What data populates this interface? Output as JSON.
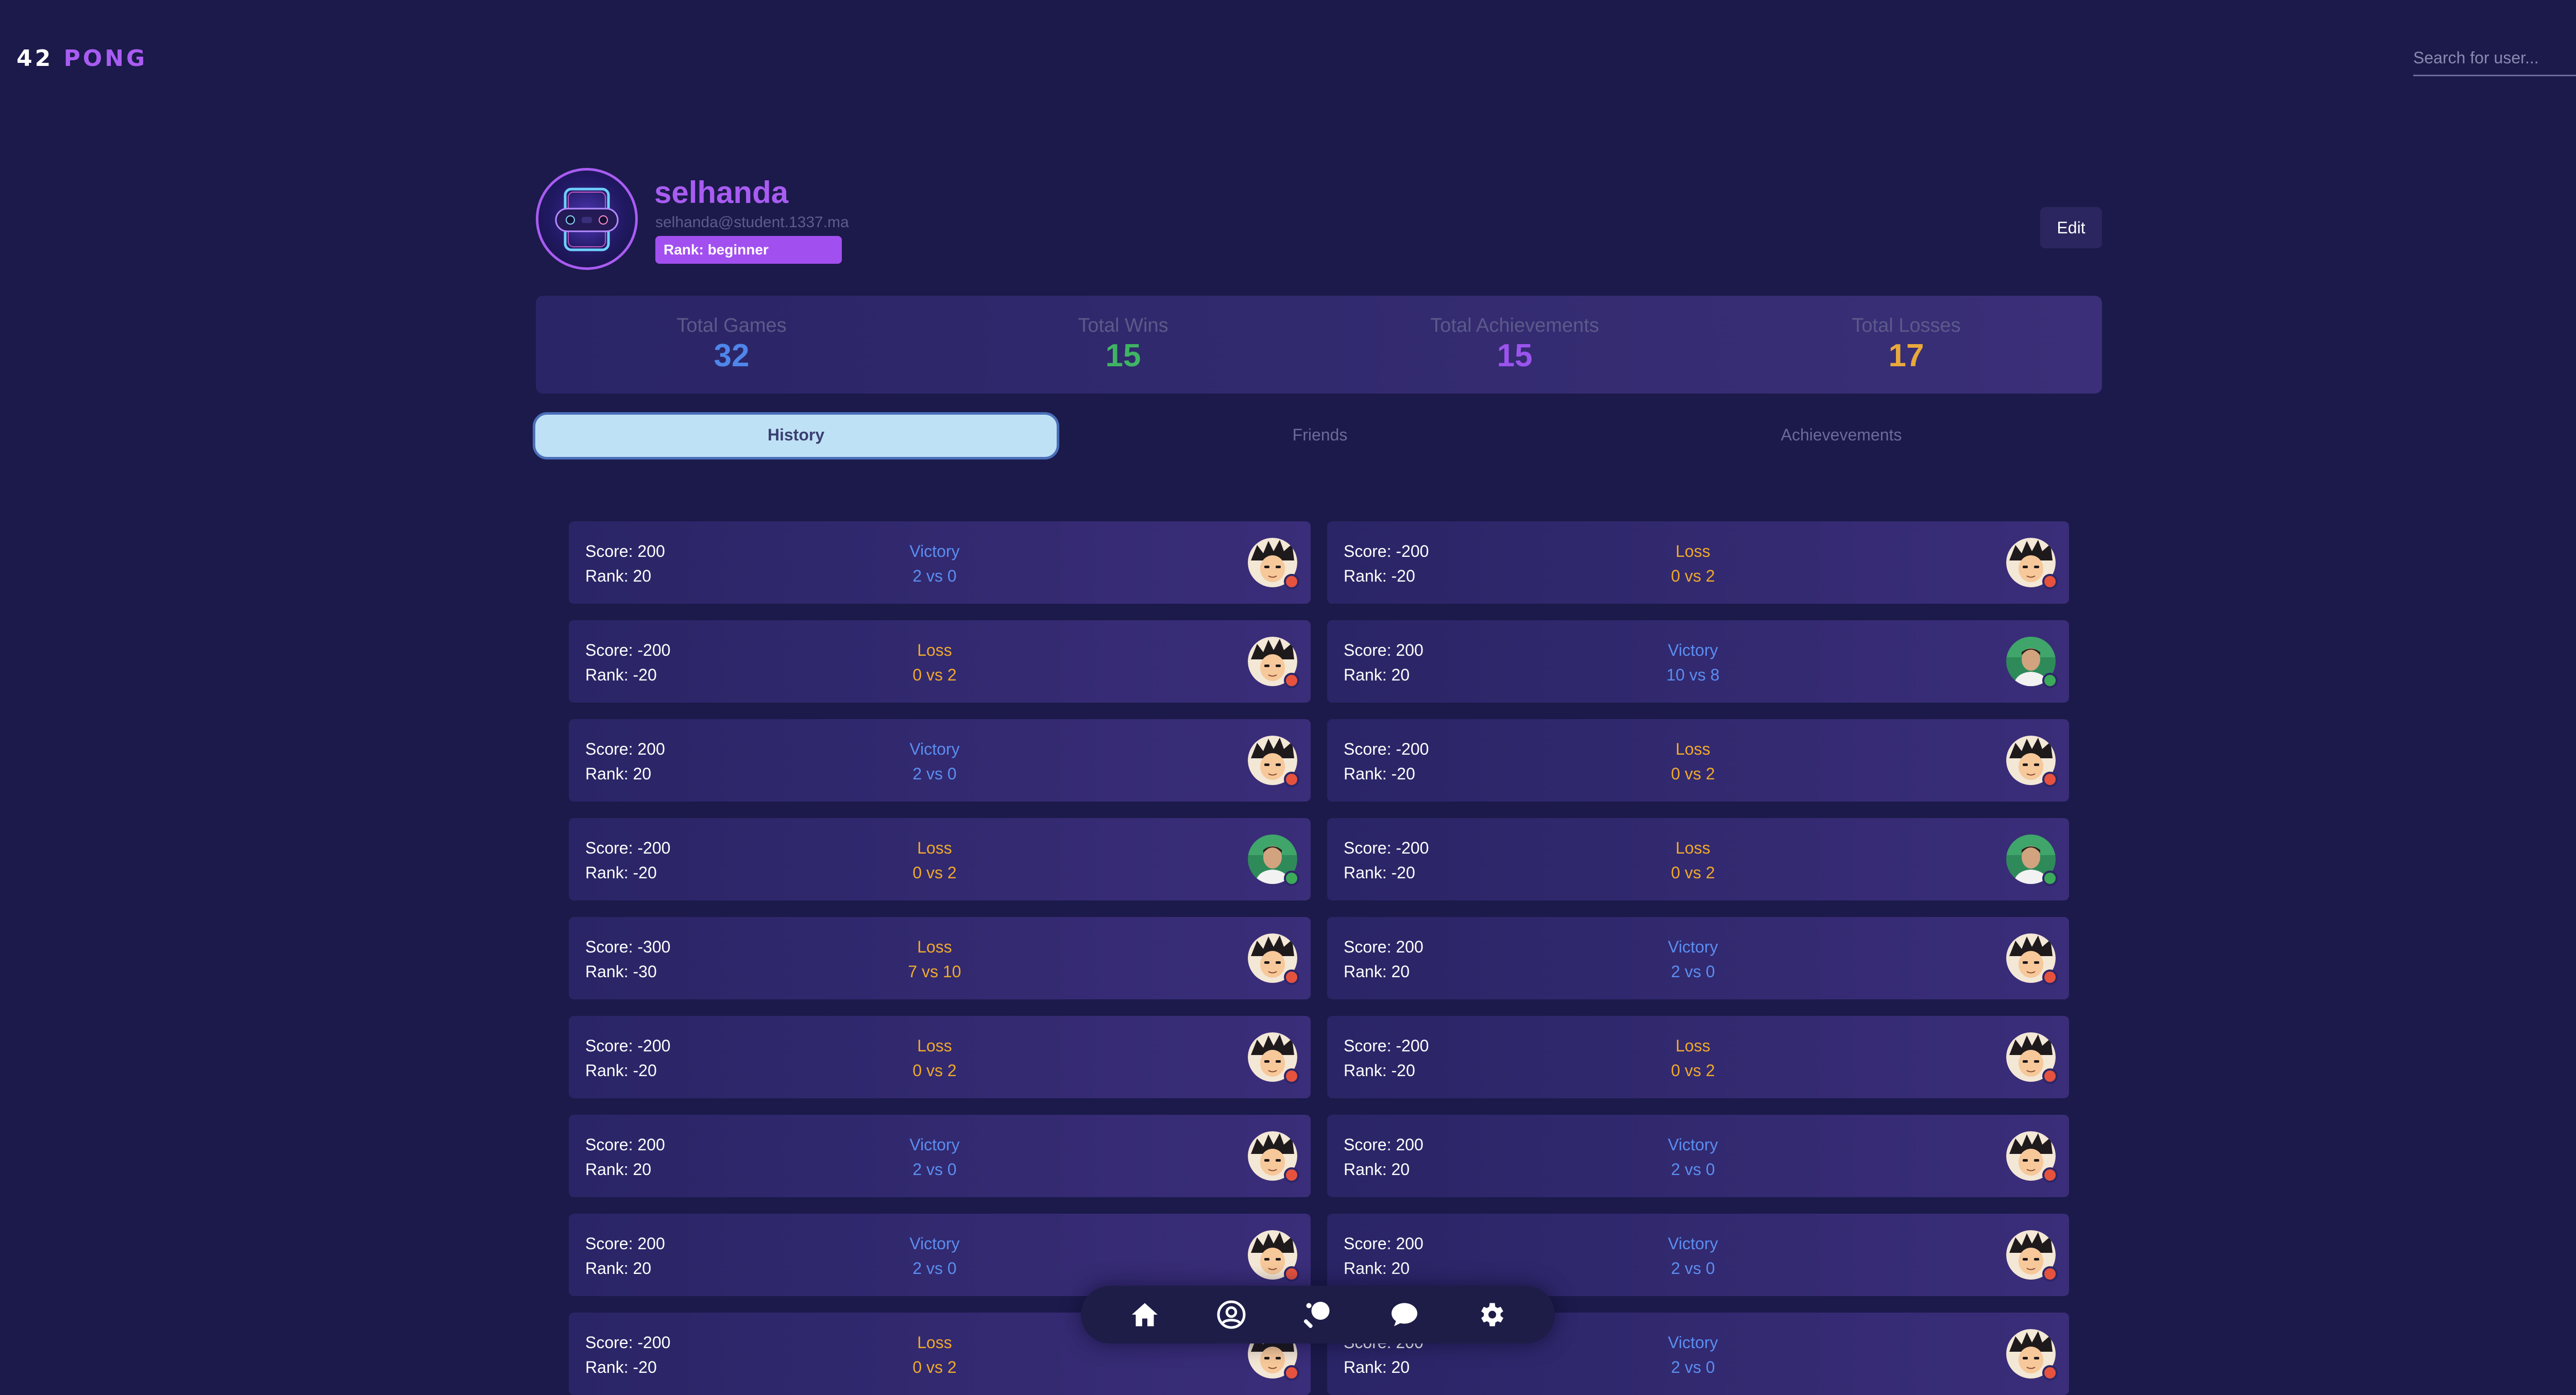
{
  "app": {
    "logo_number": "42",
    "logo_word": "PONG"
  },
  "search": {
    "placeholder": "Search for user..."
  },
  "profile": {
    "username": "selhanda",
    "email": "selhanda@student.1337.ma",
    "rank": "Rank: beginner",
    "edit_label": "Edit"
  },
  "stats": [
    {
      "label": "Total Games",
      "value": "32",
      "color": "#4f86ea"
    },
    {
      "label": "Total Wins",
      "value": "15",
      "color": "#3fb463"
    },
    {
      "label": "Total Achievements",
      "value": "15",
      "color": "#9b54ee"
    },
    {
      "label": "Total Losses",
      "value": "17",
      "color": "#e9a93a"
    }
  ],
  "tabs": [
    {
      "label": "History",
      "active": true
    },
    {
      "label": "Friends",
      "active": false
    },
    {
      "label": "Achievevements",
      "active": false
    }
  ],
  "history": [
    {
      "score": "Score: 200",
      "rank": "Rank: 20",
      "result": "Victory",
      "result_type": "victory",
      "match": "2 vs 0",
      "opponent": "anime-avatar",
      "status": "offline"
    },
    {
      "score": "Score: -200",
      "rank": "Rank: -20",
      "result": "Loss",
      "result_type": "loss",
      "match": "0 vs 2",
      "opponent": "anime-avatar",
      "status": "offline"
    },
    {
      "score": "Score: -200",
      "rank": "Rank: -20",
      "result": "Loss",
      "result_type": "loss",
      "match": "0 vs 2",
      "opponent": "anime-avatar",
      "status": "offline"
    },
    {
      "score": "Score: 200",
      "rank": "Rank: 20",
      "result": "Victory",
      "result_type": "victory",
      "match": "10 vs 8",
      "opponent": "photo-avatar",
      "status": "online"
    },
    {
      "score": "Score: 200",
      "rank": "Rank: 20",
      "result": "Victory",
      "result_type": "victory",
      "match": "2 vs 0",
      "opponent": "anime-avatar",
      "status": "offline"
    },
    {
      "score": "Score: -200",
      "rank": "Rank: -20",
      "result": "Loss",
      "result_type": "loss",
      "match": "0 vs 2",
      "opponent": "anime-avatar",
      "status": "offline"
    },
    {
      "score": "Score: -200",
      "rank": "Rank: -20",
      "result": "Loss",
      "result_type": "loss",
      "match": "0 vs 2",
      "opponent": "photo-avatar",
      "status": "online"
    },
    {
      "score": "Score: -200",
      "rank": "Rank: -20",
      "result": "Loss",
      "result_type": "loss",
      "match": "0 vs 2",
      "opponent": "photo-avatar",
      "status": "online"
    },
    {
      "score": "Score: -300",
      "rank": "Rank: -30",
      "result": "Loss",
      "result_type": "loss",
      "match": "7 vs 10",
      "opponent": "anime-avatar",
      "status": "offline"
    },
    {
      "score": "Score: 200",
      "rank": "Rank: 20",
      "result": "Victory",
      "result_type": "victory",
      "match": "2 vs 0",
      "opponent": "anime-avatar",
      "status": "offline"
    },
    {
      "score": "Score: -200",
      "rank": "Rank: -20",
      "result": "Loss",
      "result_type": "loss",
      "match": "0 vs 2",
      "opponent": "anime-avatar",
      "status": "offline"
    },
    {
      "score": "Score: -200",
      "rank": "Rank: -20",
      "result": "Loss",
      "result_type": "loss",
      "match": "0 vs 2",
      "opponent": "anime-avatar",
      "status": "offline"
    },
    {
      "score": "Score: 200",
      "rank": "Rank: 20",
      "result": "Victory",
      "result_type": "victory",
      "match": "2 vs 0",
      "opponent": "anime-avatar",
      "status": "offline"
    },
    {
      "score": "Score: 200",
      "rank": "Rank: 20",
      "result": "Victory",
      "result_type": "victory",
      "match": "2 vs 0",
      "opponent": "anime-avatar",
      "status": "offline"
    },
    {
      "score": "Score: 200",
      "rank": "Rank: 20",
      "result": "Victory",
      "result_type": "victory",
      "match": "2 vs 0",
      "opponent": "anime-avatar",
      "status": "offline"
    },
    {
      "score": "Score: 200",
      "rank": "Rank: 20",
      "result": "Victory",
      "result_type": "victory",
      "match": "2 vs 0",
      "opponent": "anime-avatar",
      "status": "offline"
    },
    {
      "score": "Score: -200",
      "rank": "Rank: -20",
      "result": "Loss",
      "result_type": "loss",
      "match": "0 vs 2",
      "opponent": "anime-avatar",
      "status": "offline"
    },
    {
      "score": "Score: 200",
      "rank": "Rank: 20",
      "result": "Victory",
      "result_type": "victory",
      "match": "2 vs 0",
      "opponent": "anime-avatar",
      "status": "offline"
    }
  ],
  "bottom_nav": [
    {
      "name": "home",
      "icon": "home-icon"
    },
    {
      "name": "profile",
      "icon": "user-circle-icon"
    },
    {
      "name": "game",
      "icon": "ping-pong-paddle-icon"
    },
    {
      "name": "chat",
      "icon": "chat-bubble-icon"
    },
    {
      "name": "settings",
      "icon": "gear-icon"
    }
  ],
  "colors": {
    "background": "#1b1a4a",
    "accent": "#a95cf2",
    "victory": "#5b8ef0",
    "loss": "#f0a92c",
    "online": "#3bab5a",
    "offline": "#e5533f"
  }
}
